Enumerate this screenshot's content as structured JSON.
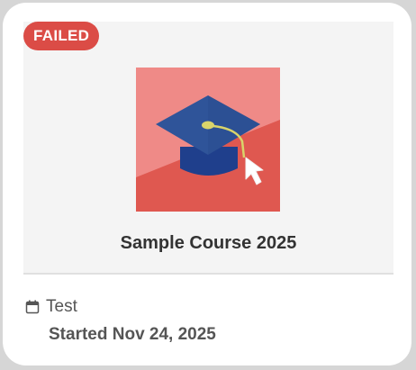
{
  "card": {
    "status_badge": "FAILED",
    "course_title": "Sample Course 2025",
    "type_label": "Test",
    "started_text": "Started Nov 24, 2025",
    "thumbnail_icon": "graduation-cap-icon"
  },
  "colors": {
    "badge_bg": "#db4c46",
    "thumb_light": "#ef8a87",
    "thumb_dark": "#df5850",
    "cap_blue": "#2f4f98"
  }
}
